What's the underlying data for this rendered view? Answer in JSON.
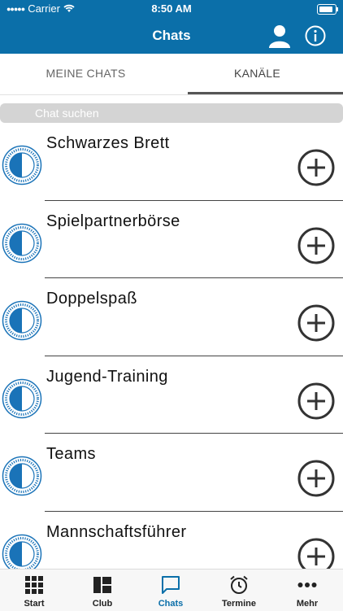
{
  "status_bar": {
    "carrier": "Carrier",
    "time": "8:50 AM"
  },
  "nav": {
    "title": "Chats",
    "profile_icon": "person-icon",
    "info_icon": "info-icon"
  },
  "tabs": [
    {
      "label": "MEINE CHATS",
      "active": false
    },
    {
      "label": "KANÄLE",
      "active": true
    }
  ],
  "search": {
    "placeholder": "Chat suchen",
    "value": ""
  },
  "channels": [
    {
      "name": "Schwarzes Brett"
    },
    {
      "name": "Spielpartnerbörse"
    },
    {
      "name": "Doppelspaß"
    },
    {
      "name": "Jugend-Training"
    },
    {
      "name": "Teams"
    },
    {
      "name": "Mannschaftsführer"
    }
  ],
  "tab_bar": [
    {
      "label": "Start",
      "icon": "grid-icon",
      "active": false
    },
    {
      "label": "Club",
      "icon": "dashboard-icon",
      "active": false
    },
    {
      "label": "Chats",
      "icon": "chat-bubble-icon",
      "active": true
    },
    {
      "label": "Termine",
      "icon": "alarm-clock-icon",
      "active": false
    },
    {
      "label": "Mehr",
      "icon": "more-dots-icon",
      "active": false
    }
  ],
  "colors": {
    "brand": "#0b6fa9",
    "club_logo": "#1a73b8"
  }
}
